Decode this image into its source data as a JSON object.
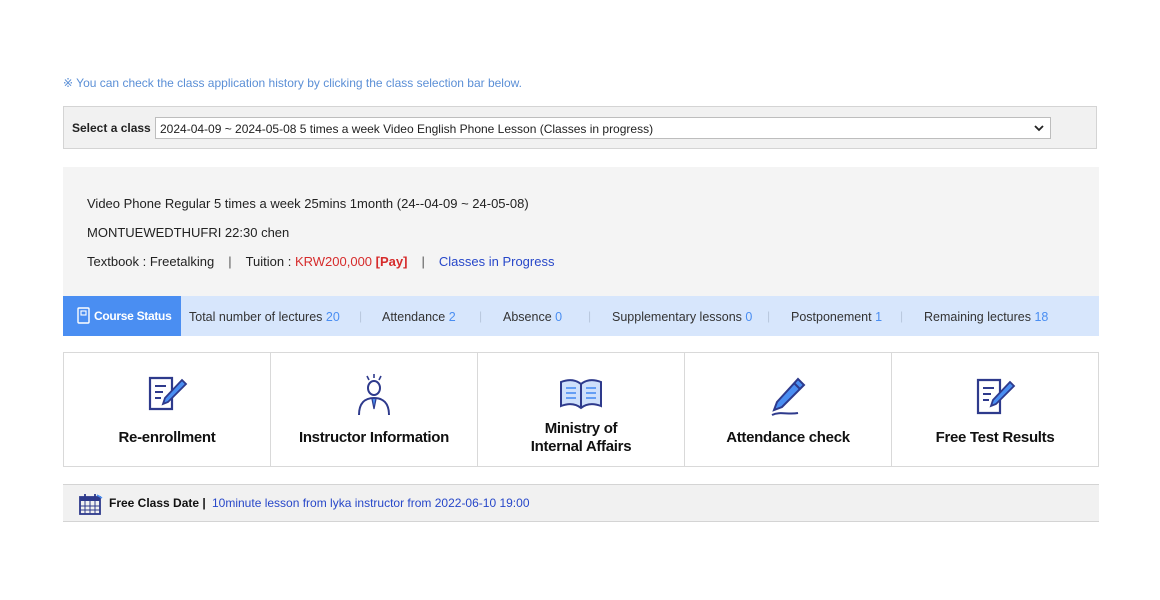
{
  "notice": "※ You can check the class application history by clicking the class selection bar below.",
  "select_class": {
    "label": "Select a class",
    "value": "2024-04-09 ~ 2024-05-08 5 times a week Video English Phone Lesson (Classes in progress)",
    "icon": "chevron-down-icon"
  },
  "course_info": {
    "line1": "Video Phone Regular 5 times a week 25mins 1month (24--04-09 ~ 24-05-08)",
    "line2": "MONTUEWEDTHUFRI 22:30 chen",
    "textbook": "Textbook : Freetalking",
    "tuition_label": "Tuition : ",
    "tuition_amount": "KRW200,000",
    "pay_label": "[Pay]",
    "status_link": "Classes in Progress",
    "separator": "|"
  },
  "course_status": {
    "badge": "Course Status",
    "badge_icon": "notebook-icon",
    "separator": "|",
    "items": [
      {
        "label": "Total number of lectures",
        "value": "20"
      },
      {
        "label": "Attendance",
        "value": "2"
      },
      {
        "label": "Absence",
        "value": "0"
      },
      {
        "label": "Supplementary lessons",
        "value": "0"
      },
      {
        "label": "Postponement",
        "value": "1"
      },
      {
        "label": "Remaining lectures",
        "value": "18"
      }
    ],
    "accent_color": "#4a8ef2"
  },
  "tiles": [
    {
      "label": "Re-enrollment",
      "icon": "document-edit-icon"
    },
    {
      "label": "Instructor Information",
      "icon": "instructor-icon"
    },
    {
      "label_line1": "Ministry of",
      "label_line2": "Internal Affairs",
      "icon": "open-book-icon"
    },
    {
      "label": "Attendance check",
      "icon": "pen-icon"
    },
    {
      "label": "Free Test Results",
      "icon": "test-document-icon"
    }
  ],
  "free_class": {
    "label": "Free Class Date |",
    "text": "10minute lesson from lyka instructor from 2022-06-10 19:00",
    "icon": "calendar-icon"
  }
}
